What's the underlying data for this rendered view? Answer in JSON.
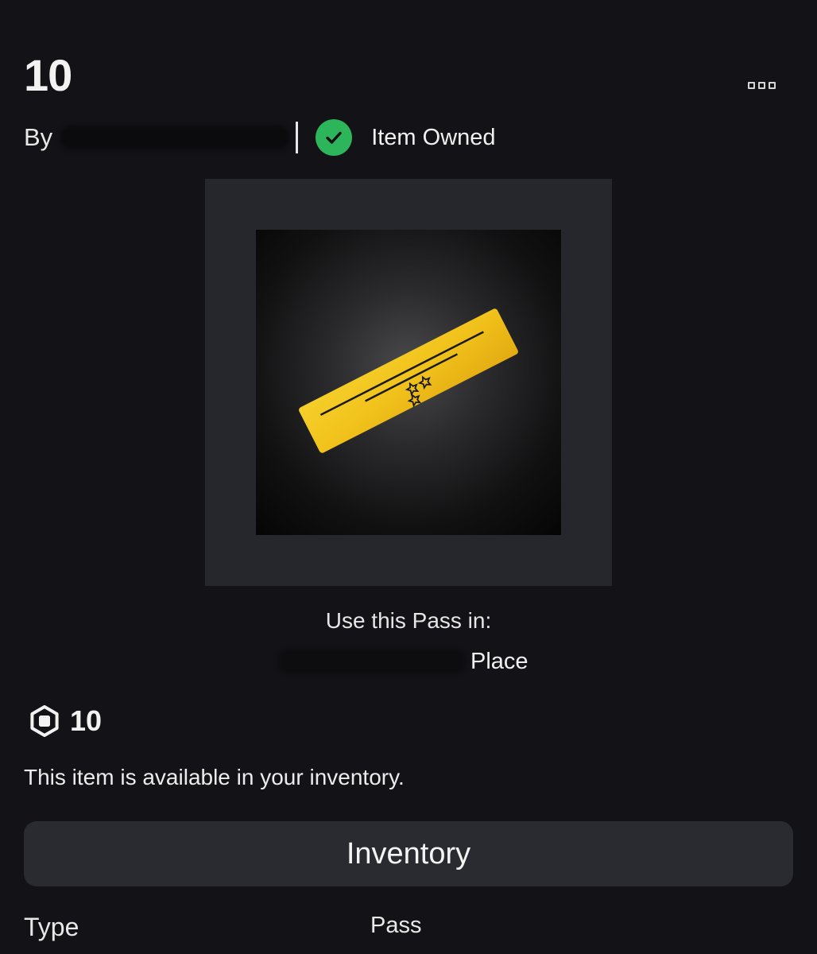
{
  "item": {
    "title": "10",
    "by_label": "By",
    "owned_label": "Item Owned"
  },
  "menu": {
    "icon": "more-options-icon"
  },
  "thumbnail": {
    "icon": "pass-ticket-icon",
    "ticket_color": "#f2c21a"
  },
  "usage": {
    "use_in_label": "Use this Pass in:",
    "place_suffix": "Place"
  },
  "price": {
    "icon": "robux-icon",
    "value": "10"
  },
  "status_text": "This item is available in your inventory.",
  "actions": {
    "inventory_label": "Inventory"
  },
  "details": {
    "type_label": "Type",
    "type_value": "Pass"
  },
  "colors": {
    "background": "#121217",
    "owned_green": "#2cb55a",
    "button_bg": "#2a2b30"
  }
}
